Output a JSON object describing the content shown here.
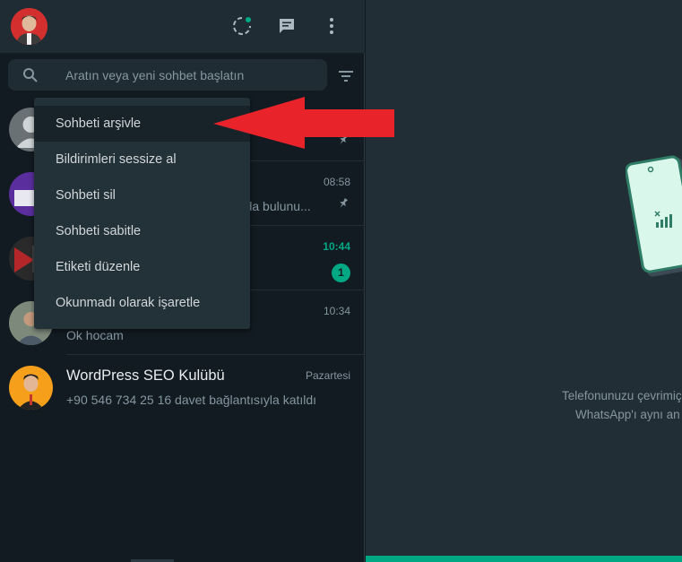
{
  "header": {
    "avatar_alt": "profile-photo",
    "icons": [
      "status-icon",
      "new-chat-icon",
      "menu-icon"
    ]
  },
  "search": {
    "placeholder": "Aratın veya yeni sohbet başlatın",
    "value": ""
  },
  "chats": [
    {
      "name": "",
      "time": "",
      "message": "",
      "pinned": true,
      "unread": ""
    },
    {
      "name": "",
      "time": "08:58",
      "message": "unda bulunu...",
      "pinned": true,
      "unread": ""
    },
    {
      "name": "",
      "time": "10:44",
      "message": "",
      "pinned": false,
      "unread": "1"
    },
    {
      "name": "",
      "time": "10:34",
      "message": "Ok hocam",
      "pinned": false,
      "unread": ""
    },
    {
      "name": "WordPress SEO Kulübü",
      "time": "Pazartesi",
      "message": "+90 546 734 25 16 davet bağlantısıyla katıldı",
      "pinned": false,
      "unread": ""
    }
  ],
  "context_menu": {
    "items": [
      "Sohbeti arşivle",
      "Bildirimleri sessize al",
      "Sohbeti sil",
      "Sohbeti sabitle",
      "Etiketi düzenle",
      "Okunmadı olarak işaretle"
    ]
  },
  "main": {
    "intro_line1": "Telefonunuzu çevrimiç",
    "intro_line2": "WhatsApp'ı aynı an"
  },
  "colors": {
    "accent": "#00a884",
    "unread_time": "#00a884",
    "annotation_arrow": "#e8232a"
  }
}
